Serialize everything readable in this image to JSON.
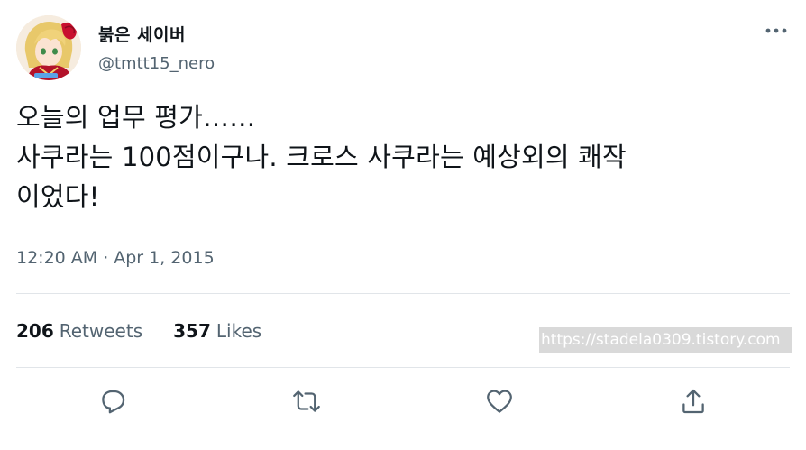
{
  "author": {
    "display_name": "붉은 세이버",
    "handle": "@tmtt15_nero"
  },
  "tweet": {
    "text_lines": [
      "오늘의 업무 평가……",
      "사쿠라는 100점이구나. 크로스 사쿠라는 예상외의 쾌작",
      "이었다!"
    ],
    "time": "12:20 AM",
    "separator": "·",
    "date": "Apr 1, 2015"
  },
  "stats": {
    "retweets_count": "206",
    "retweets_label": "Retweets",
    "likes_count": "357",
    "likes_label": "Likes"
  },
  "watermark": "https://stadela0309.tistory.com",
  "icons": {
    "more": "more-horizontal-icon",
    "reply": "reply-icon",
    "retweet": "retweet-icon",
    "like": "heart-icon",
    "share": "share-icon"
  },
  "colors": {
    "text_primary": "#0f1419",
    "text_secondary": "#536471",
    "divider": "#e1e5e9",
    "watermark_bg": "#d9d9d9"
  }
}
